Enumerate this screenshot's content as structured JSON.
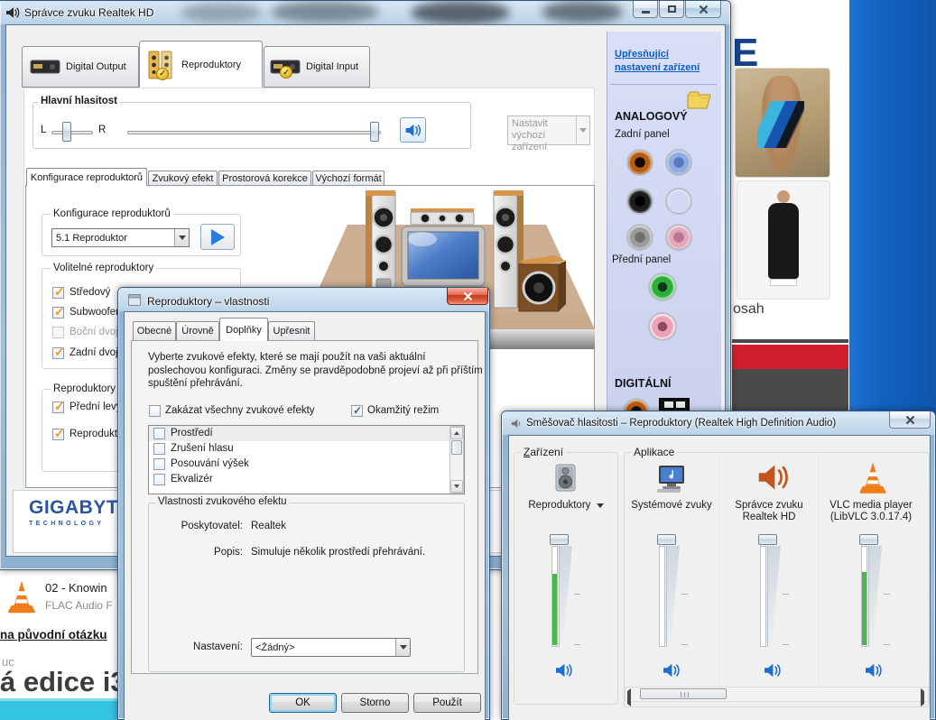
{
  "colors": {
    "meter_green": "#46b946",
    "link_blue": "#0b5cc4",
    "brand_blue": "#2c55a0",
    "mute_icon_blue": "#1f6fd0",
    "red_bar": "#cf1f2e",
    "cyan_strip": "#35c3e3",
    "desktop_blue": "#1464c2"
  },
  "realtek_window": {
    "title": "Správce zvuku Realtek HD",
    "device_tabs": [
      {
        "label": "Digital Output"
      },
      {
        "label": "Reproduktory"
      },
      {
        "label": "Digital Input"
      }
    ],
    "advanced_link": "Upřesňující nastavení zařízení",
    "main_volume": {
      "group_label": "Hlavní hlasitost",
      "left_label": "L",
      "right_label": "R"
    },
    "set_default_button_label": "Nastavit výchozí zařízení",
    "sub_tabs": [
      {
        "label": "Konfigurace reproduktorů"
      },
      {
        "label": "Zvukový efekt"
      },
      {
        "label": "Prostorová korekce"
      },
      {
        "label": "Výchozí formát"
      }
    ],
    "speaker_config_group": {
      "label": "Konfigurace reproduktorů",
      "selected": "5.1 Reproduktor"
    },
    "optional_group": {
      "label": "Volitelné reproduktory",
      "items": [
        {
          "label": "Středový",
          "checked": true
        },
        {
          "label": "Subwoofer",
          "checked": true
        },
        {
          "label": "Boční dvoji",
          "checked": false,
          "disabled": true
        },
        {
          "label": "Zadní dvoji",
          "checked": true
        }
      ]
    },
    "surround_group": {
      "label": "Reproduktory s",
      "items": [
        {
          "label": "Přední levý",
          "checked": true
        },
        {
          "label": "Reprodukt",
          "checked": true
        }
      ]
    },
    "jack_panel": {
      "analog_label": "ANALOGOVÝ",
      "rear_label": "Zadní panel",
      "front_label": "Přední panel",
      "digital_label": "DIGITÁLNÍ",
      "rear_jacks": [
        "orange",
        "light-blue",
        "black",
        "green",
        "gray",
        "pink"
      ],
      "front_jacks": [
        "green",
        "pink"
      ]
    },
    "brand": {
      "name": "GIGABYTE",
      "tagline": "TECHNOLOGY"
    }
  },
  "properties_dialog": {
    "title": "Reproduktory – vlastnosti",
    "tabs": [
      {
        "label": "Obecné"
      },
      {
        "label": "Úrovně"
      },
      {
        "label": "Doplňky"
      },
      {
        "label": "Upřesnit"
      }
    ],
    "active_tab": "Doplňky",
    "description": "Vyberte zvukové efekty, které se mají použít na vaši aktuální poslechovou konfiguraci. Změny se pravděpodobně projeví až při příštím spuštění přehrávání.",
    "disable_all_checkbox": {
      "label": "Zakázat všechny zvukové efekty",
      "checked": false
    },
    "immediate_checkbox": {
      "label": "Okamžitý režim",
      "checked": true
    },
    "effects_list": [
      {
        "label": "Prostředí",
        "checked": false
      },
      {
        "label": "Zrušení hlasu",
        "checked": false
      },
      {
        "label": "Posouvání výšek",
        "checked": false
      },
      {
        "label": "Ekvalizér",
        "checked": false
      }
    ],
    "effect_props_group": {
      "label": "Vlastnosti zvukového efektu",
      "provider_label": "Poskytovatel:",
      "provider_value": "Realtek",
      "description_label": "Popis:",
      "description_value": "Simuluje několik prostředí přehrávání.",
      "setting_label": "Nastavení:",
      "setting_value": "<Žádný>"
    },
    "buttons": {
      "ok": "OK",
      "cancel": "Storno",
      "apply": "Použít"
    }
  },
  "mixer": {
    "title": "Směšovač hlasitosti – Reproduktory (Realtek High Definition Audio)",
    "device_group_label": "Zařízení",
    "apps_group_label": "Aplikace",
    "columns": [
      {
        "label": "Reproduktory",
        "icon": "speakers-icon",
        "meter": 0.72,
        "muted": false
      },
      {
        "label": "Systémové zvuky",
        "icon": "system-sounds-icon",
        "meter": 0,
        "muted": false
      },
      {
        "label": "Správce zvuku Realtek HD",
        "icon": "realtek-speaker-icon",
        "meter": 0,
        "muted": false
      },
      {
        "label": "VLC media player (LibVLC 3.0.17.4)",
        "icon": "vlc-cone-icon",
        "meter": 0.74,
        "muted": false
      }
    ]
  },
  "background": {
    "headline_fragment": "E",
    "content_fragment": "osah",
    "download_item": {
      "title": "02 - Knowin",
      "subtitle": "FLAC Audio F"
    },
    "link_fragment": "na původní otázku",
    "small_text_fragment": "uc",
    "heading_fragment": "á edice i3"
  }
}
